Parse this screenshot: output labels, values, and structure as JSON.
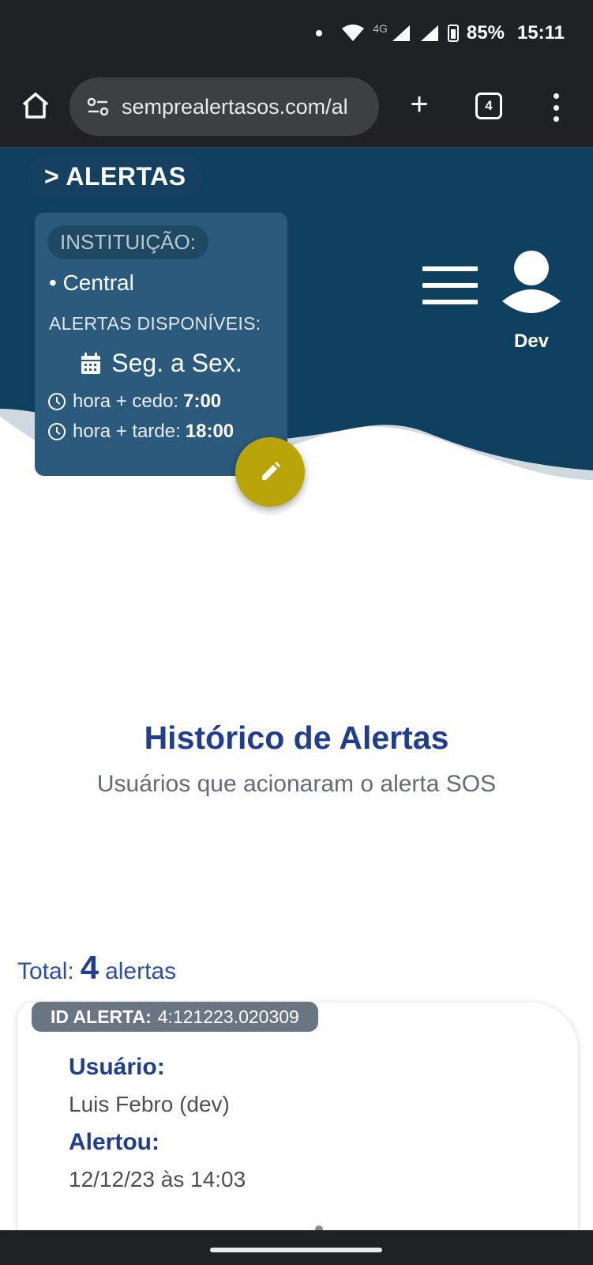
{
  "status_bar": {
    "network": "4G",
    "battery": "85%",
    "time": "15:11"
  },
  "browser": {
    "url": "semprealertasos.com/al",
    "tab_count": "4",
    "new_tab_symbol": "+"
  },
  "header": {
    "section_title": "> ALERTAS",
    "institution_label": "INSTITUIÇÃO:",
    "institution_value": "• Central",
    "available_label": "ALERTAS DISPONÍVEIS:",
    "days": "Seg. a Sex.",
    "early_label": "hora + cedo:",
    "early_time": "7:00",
    "late_label": "hora + tarde:",
    "late_time": "18:00",
    "user_name": "Dev",
    "colors": {
      "header_bg": "#10405f",
      "wave_light": "#cfd9e0",
      "fab": "#b9a40a"
    },
    "icons": [
      "calendar-icon",
      "clock-icon",
      "edit-icon",
      "menu-icon",
      "user-icon"
    ]
  },
  "main": {
    "title": "Histórico de Alertas",
    "subtitle": "Usuários que acionaram o alerta SOS",
    "total_prefix": "Total:",
    "total_count": "4",
    "total_suffix": "alertas"
  },
  "alert": {
    "id_label": "ID ALERTA:",
    "id_value": "4:121223.020309",
    "user_label": "Usuário:",
    "user_value": "Luis Febro (dev)",
    "alerted_label": "Alertou:",
    "alerted_value": "12/12/23 às 14:03"
  }
}
